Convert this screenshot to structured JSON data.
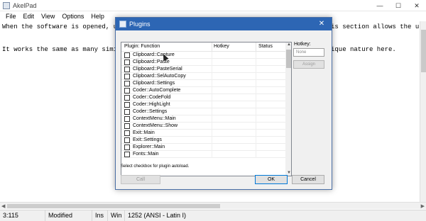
{
  "window": {
    "title": "AkelPad",
    "controls": {
      "minimize": "—",
      "maximize": "☐",
      "close": "✕"
    }
  },
  "menu": [
    "File",
    "Edit",
    "View",
    "Options",
    "Help"
  ],
  "editor": {
    "lines": [
      "When the software is opened, user",
      "",
      "It works the same as many similar"
    ],
    "right_fragments": [
      "is section allows the user",
      "",
      "ique nature here."
    ]
  },
  "status": {
    "position": "3:115",
    "modified": "Modified",
    "ins": "Ins",
    "win": "Win",
    "encoding": "1252  (ANSI - Latin I)"
  },
  "dialog": {
    "title": "Plugins",
    "close": "✕",
    "columns": [
      "Plugin: Function",
      "Hotkey",
      "Status"
    ],
    "plugins": [
      "Clipboard::Capture",
      "Clipboard::Paste",
      "Clipboard::PasteSerial",
      "Clipboard::SelAutoCopy",
      "Clipboard::Settings",
      "Coder::AutoComplete",
      "Coder::CodeFold",
      "Coder::HighLight",
      "Coder::Settings",
      "ContextMenu::Main",
      "ContextMenu::Show",
      "Exit::Main",
      "Exit::Settings",
      "Explorer::Main",
      "Fonts::Main"
    ],
    "hotkey_label": "Hotkey:",
    "hotkey_value": "None",
    "assign": "Assign",
    "hint": "Select checkbox for plugin autoload.",
    "call": "Call",
    "ok": "OK",
    "cancel": "Cancel"
  }
}
